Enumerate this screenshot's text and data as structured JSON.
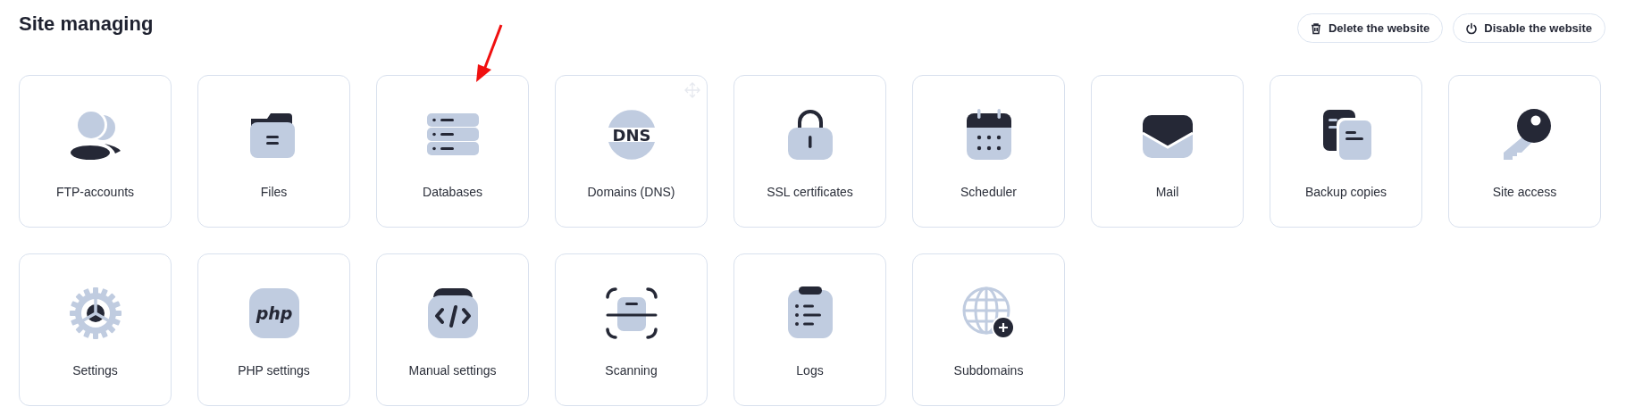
{
  "title": "Site managing",
  "actions": [
    {
      "label": "Delete the website",
      "kind": "trash"
    },
    {
      "label": "Disable the website",
      "kind": "power"
    }
  ],
  "tiles": [
    {
      "label": "FTP-accounts",
      "kind": "users",
      "hovered": false,
      "pointed": false
    },
    {
      "label": "Files",
      "kind": "folder",
      "hovered": false,
      "pointed": false
    },
    {
      "label": "Databases",
      "kind": "database",
      "hovered": false,
      "pointed": true
    },
    {
      "label": "Domains (DNS)",
      "kind": "dns",
      "icon_text": "DNS",
      "hovered": true,
      "pointed": false
    },
    {
      "label": "SSL certificates",
      "kind": "lock",
      "hovered": false,
      "pointed": false
    },
    {
      "label": "Scheduler",
      "kind": "calendar",
      "hovered": false,
      "pointed": false
    },
    {
      "label": "Mail",
      "kind": "mail",
      "hovered": false,
      "pointed": false
    },
    {
      "label": "Backup copies",
      "kind": "copies",
      "hovered": false,
      "pointed": false
    },
    {
      "label": "Site access",
      "kind": "key",
      "hovered": false,
      "pointed": false
    },
    {
      "label": "Settings",
      "kind": "gear",
      "hovered": false,
      "pointed": false
    },
    {
      "label": "PHP settings",
      "kind": "php",
      "icon_text": "php",
      "hovered": false,
      "pointed": false
    },
    {
      "label": "Manual settings",
      "kind": "code",
      "hovered": false,
      "pointed": false
    },
    {
      "label": "Scanning",
      "kind": "scan",
      "hovered": false,
      "pointed": false
    },
    {
      "label": "Logs",
      "kind": "clipboard",
      "hovered": false,
      "pointed": false
    },
    {
      "label": "Subdomains",
      "kind": "globe",
      "hovered": false,
      "pointed": false
    }
  ]
}
